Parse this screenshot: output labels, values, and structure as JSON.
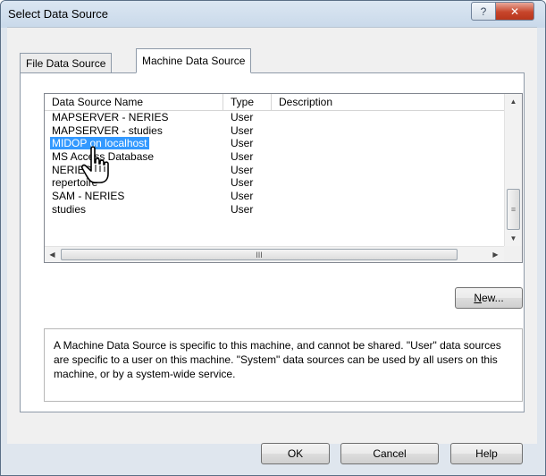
{
  "window": {
    "title": "Select Data Source",
    "help_glyph": "?",
    "close_glyph": "✕"
  },
  "tabs": [
    {
      "label": "File Data Source",
      "active": false
    },
    {
      "label": "Machine Data Source",
      "active": true
    }
  ],
  "listview": {
    "columns": [
      "Data Source Name",
      "Type",
      "Description"
    ],
    "rows": [
      {
        "name": "MAPSERVER - NERIES",
        "type": "User",
        "description": ""
      },
      {
        "name": "MAPSERVER - studies",
        "type": "User",
        "description": ""
      },
      {
        "name": "MIDOP on localhost",
        "type": "User",
        "description": "",
        "selected": true
      },
      {
        "name": "MS Access Database",
        "type": "User",
        "description": ""
      },
      {
        "name": "NERIES",
        "type": "User",
        "description": ""
      },
      {
        "name": "repertoire",
        "type": "User",
        "description": ""
      },
      {
        "name": "SAM - NERIES",
        "type": "User",
        "description": ""
      },
      {
        "name": "studies",
        "type": "User",
        "description": ""
      }
    ],
    "scroll_up": "▲",
    "scroll_down": "▼",
    "scroll_left": "◀",
    "scroll_right": "▶",
    "vthumb_grip": "≡",
    "hthumb_grip": "III"
  },
  "buttons": {
    "new_prefix": "N",
    "new_rest": "ew...",
    "ok": "OK",
    "cancel": "Cancel",
    "help": "Help"
  },
  "info": {
    "text": "A Machine Data Source is specific to this machine, and cannot be shared. \"User\" data sources are specific to a user on this machine.  \"System\" data sources can be used by all users on this machine, or by a system-wide service."
  },
  "icons": {
    "cursor": "hand-pointer-icon"
  },
  "colors": {
    "selection": "#3399ff",
    "close_button": "#c7452b"
  }
}
